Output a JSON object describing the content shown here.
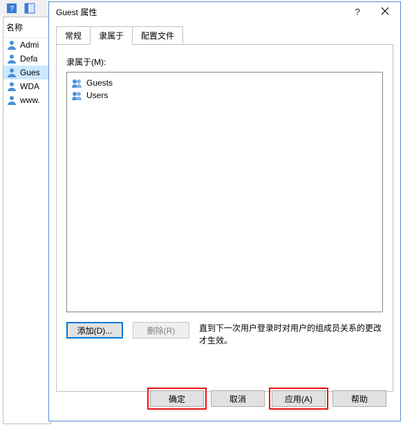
{
  "toolbar": {
    "help_icon": "help-icon",
    "panel_icon": "panel-icon"
  },
  "leftpanel": {
    "header": "名称",
    "items": [
      {
        "label": "Admi",
        "selected": false
      },
      {
        "label": "Defa",
        "selected": false
      },
      {
        "label": "Gues",
        "selected": true
      },
      {
        "label": "WDA",
        "selected": false
      },
      {
        "label": "www.",
        "selected": false
      }
    ]
  },
  "dialog": {
    "title": "Guest 属性",
    "help": "?",
    "close": "×",
    "tabs": [
      {
        "label": "常规",
        "active": false
      },
      {
        "label": "隶属于",
        "active": true
      },
      {
        "label": "配置文件",
        "active": false
      }
    ],
    "memberof": {
      "label": "隶属于(M):",
      "items": [
        {
          "label": "Guests"
        },
        {
          "label": "Users"
        }
      ],
      "add": "添加(D)...",
      "remove": "删除(R)",
      "note": "直到下一次用户登录时对用户的组成员关系的更改才生效。"
    },
    "buttons": {
      "ok": "确定",
      "cancel": "取消",
      "apply": "应用(A)",
      "help": "帮助"
    }
  }
}
